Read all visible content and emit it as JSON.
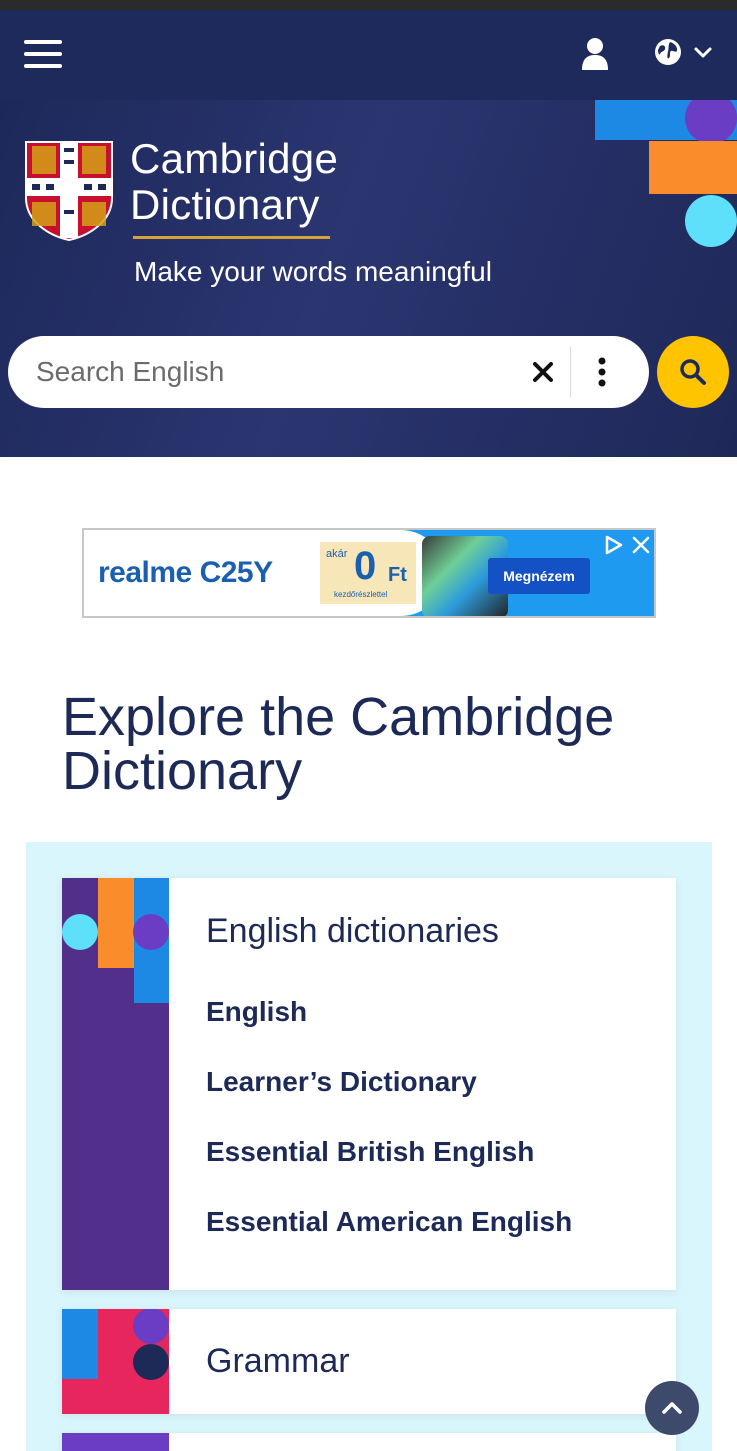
{
  "header": {
    "menu_icon": "hamburger-menu-icon",
    "user_icon": "user-icon",
    "language_icon": "globe-icon"
  },
  "hero": {
    "logo_line1": "Cambridge",
    "logo_line2": "Dictionary",
    "tagline": "Make your words meaningful"
  },
  "search": {
    "placeholder": "Search English",
    "value": ""
  },
  "ad": {
    "brand": "realme C25Y",
    "offer_small": "akár",
    "offer_zero": "0",
    "offer_currency": "Ft",
    "offer_sub": "kezdőrészlettel",
    "cta": "Megnézem"
  },
  "explore": {
    "title": "Explore the Cambridge Dictionary",
    "cards": [
      {
        "heading": "English dictionaries",
        "links": [
          "English",
          "Learner’s Dictionary",
          "Essential British English",
          "Essential American English"
        ]
      },
      {
        "heading": "Grammar",
        "links": []
      }
    ]
  },
  "colors": {
    "navy": "#1f2a5c",
    "accent_yellow": "#fec400",
    "accent_blue": "#1e88e5",
    "accent_orange": "#fb8c2b",
    "accent_cyan": "#5ee0fb",
    "accent_purple": "#6b3cc4",
    "explore_bg": "#d9f6fc",
    "text_navy": "#1d2a57"
  }
}
